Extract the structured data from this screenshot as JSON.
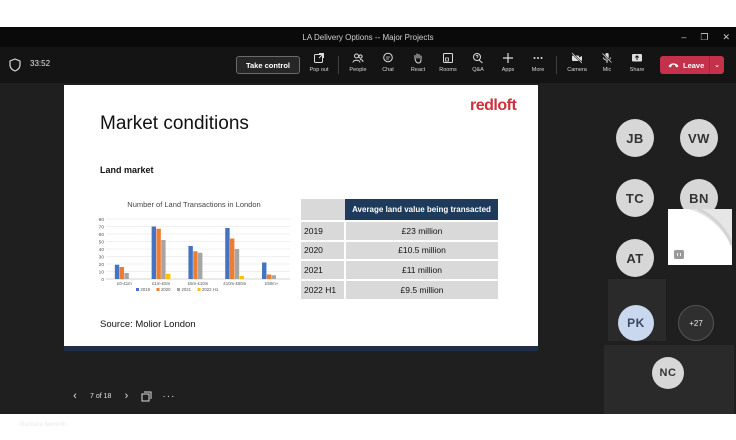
{
  "window": {
    "title": "LA Delivery Options -- Major Projects",
    "controls": [
      "–",
      "❐",
      "✕"
    ]
  },
  "toolbar": {
    "timer": "33:52",
    "take_control": "Take control",
    "buttons": [
      {
        "label": "Pop out",
        "icon": "pop-out-icon"
      },
      {
        "label": "People",
        "icon": "people-icon"
      },
      {
        "label": "Chat",
        "icon": "chat-icon"
      },
      {
        "label": "React",
        "icon": "hand-icon"
      },
      {
        "label": "Rooms",
        "icon": "rooms-icon"
      },
      {
        "label": "Q&A",
        "icon": "qa-icon"
      },
      {
        "label": "Apps",
        "icon": "plus-icon"
      },
      {
        "label": "More",
        "icon": "more-icon"
      },
      {
        "label": "Camera",
        "icon": "camera-off-icon"
      },
      {
        "label": "Mic",
        "icon": "mic-off-icon"
      },
      {
        "label": "Share",
        "icon": "share-icon"
      }
    ],
    "leave": "Leave"
  },
  "slide": {
    "logo": "redloft",
    "title": "Market conditions",
    "subtitle": "Land market",
    "source": "Source: Molior London",
    "table": {
      "header": "Average land value being transacted",
      "rows": [
        {
          "year": "2019",
          "value": "£23 million"
        },
        {
          "year": "2020",
          "value": "£10.5 million"
        },
        {
          "year": "2021",
          "value": "£11 million"
        },
        {
          "year": "2022 H1",
          "value": "£9.5 million"
        }
      ]
    }
  },
  "chart_data": {
    "type": "bar",
    "title": "Number of Land Transactions in London",
    "categories": [
      "£0-£1m",
      "£1m-£5m",
      "£5m-£10m",
      "£10m-£50m",
      "£50m+"
    ],
    "ylim": [
      0,
      80
    ],
    "yticks": [
      0,
      10,
      20,
      30,
      40,
      50,
      60,
      70,
      80
    ],
    "series": [
      {
        "name": "2019",
        "color": "#4472c4",
        "values": [
          19,
          70,
          44,
          68,
          22
        ]
      },
      {
        "name": "2020",
        "color": "#ed7d31",
        "values": [
          16,
          67,
          37,
          54,
          6
        ]
      },
      {
        "name": "2021",
        "color": "#a5a5a5",
        "values": [
          8,
          52,
          35,
          40,
          5
        ]
      },
      {
        "name": "2022 H1",
        "color": "#ffc000",
        "values": [
          0,
          7,
          0,
          4,
          0
        ]
      }
    ],
    "legend": "bottom",
    "grid": true
  },
  "slide_nav": {
    "counter": "7 of 18"
  },
  "presenter": "Barbara Nemeth",
  "participants": {
    "avatars": [
      "JB",
      "VW",
      "TC",
      "BN",
      "AT"
    ],
    "pk": "PK",
    "more": "+27",
    "nc": "NC"
  }
}
